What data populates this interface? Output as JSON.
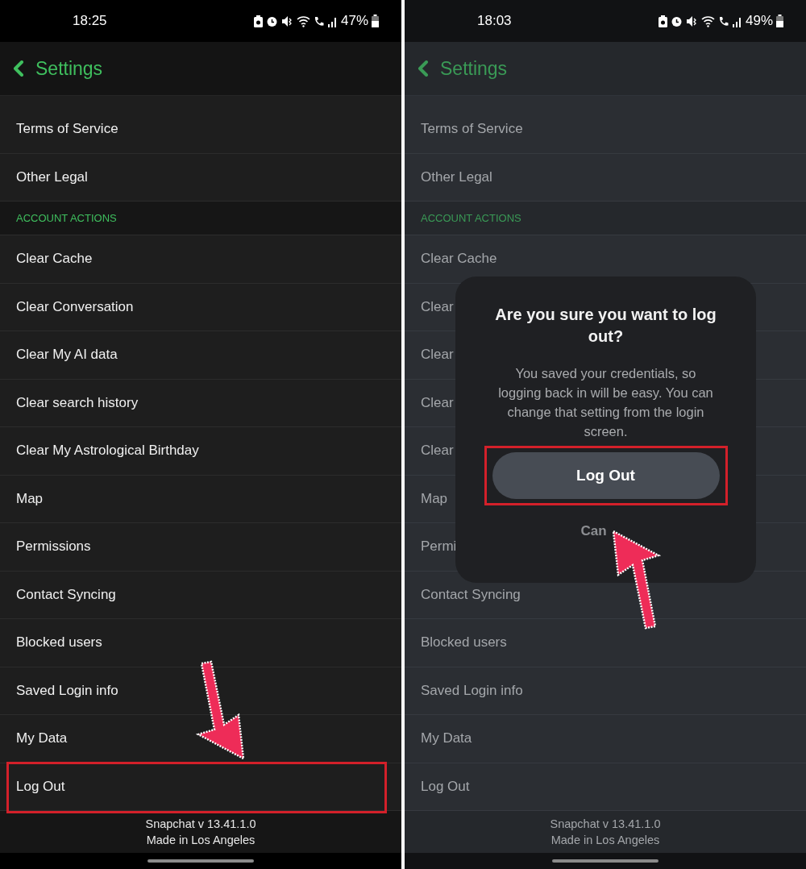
{
  "panels": [
    {
      "dimmed": false,
      "status_bar": {
        "time": "18:25",
        "battery": "47%"
      },
      "header": {
        "title": "Settings"
      },
      "items": [
        {
          "kind": "row",
          "label": "Terms of Service",
          "highlighted": false
        },
        {
          "kind": "row",
          "label": "Other Legal",
          "highlighted": false
        },
        {
          "kind": "section",
          "label": "ACCOUNT ACTIONS"
        },
        {
          "kind": "row",
          "label": "Clear Cache",
          "highlighted": false
        },
        {
          "kind": "row",
          "label": "Clear Conversation",
          "highlighted": false
        },
        {
          "kind": "row",
          "label": "Clear My AI data",
          "highlighted": false
        },
        {
          "kind": "row",
          "label": "Clear search history",
          "highlighted": false
        },
        {
          "kind": "row",
          "label": "Clear My Astrological Birthday",
          "highlighted": false
        },
        {
          "kind": "row",
          "label": "Map",
          "highlighted": false
        },
        {
          "kind": "row",
          "label": "Permissions",
          "highlighted": false
        },
        {
          "kind": "row",
          "label": "Contact Syncing",
          "highlighted": false
        },
        {
          "kind": "row",
          "label": "Blocked users",
          "highlighted": false
        },
        {
          "kind": "row",
          "label": "Saved Login info",
          "highlighted": false
        },
        {
          "kind": "row",
          "label": "My Data",
          "highlighted": false
        },
        {
          "kind": "row",
          "label": "Log Out",
          "highlighted": true
        }
      ],
      "footer": [
        "Snapchat v 13.41.1.0",
        "Made in Los Angeles"
      ]
    },
    {
      "dimmed": true,
      "status_bar": {
        "time": "18:03",
        "battery": "49%"
      },
      "header": {
        "title": "Settings"
      },
      "items": [
        {
          "kind": "row",
          "label": "Terms of Service",
          "highlighted": false
        },
        {
          "kind": "row",
          "label": "Other Legal",
          "highlighted": false
        },
        {
          "kind": "section",
          "label": "ACCOUNT ACTIONS"
        },
        {
          "kind": "row",
          "label": "Clear Cache",
          "highlighted": false
        },
        {
          "kind": "row",
          "label": "Clear",
          "highlighted": false
        },
        {
          "kind": "row",
          "label": "Clear",
          "highlighted": false
        },
        {
          "kind": "row",
          "label": "Clear",
          "highlighted": false
        },
        {
          "kind": "row",
          "label": "Clear",
          "highlighted": false
        },
        {
          "kind": "row",
          "label": "Map",
          "highlighted": false
        },
        {
          "kind": "row",
          "label": "Permi",
          "highlighted": false
        },
        {
          "kind": "row",
          "label": "Contact Syncing",
          "highlighted": false
        },
        {
          "kind": "row",
          "label": "Blocked users",
          "highlighted": false
        },
        {
          "kind": "row",
          "label": "Saved Login info",
          "highlighted": false
        },
        {
          "kind": "row",
          "label": "My Data",
          "highlighted": false
        },
        {
          "kind": "row",
          "label": "Log Out",
          "highlighted": false
        }
      ],
      "footer": [
        "Snapchat v 13.41.1.0",
        "Made in Los Angeles"
      ],
      "dialog": {
        "title": "Are you sure you want to log out?",
        "message": "You saved your credentials, so logging back in will be easy. You can change that setting from the login screen.",
        "confirm": {
          "label": "Log Out",
          "highlighted": true
        },
        "cancel": "Can"
      }
    }
  ]
}
